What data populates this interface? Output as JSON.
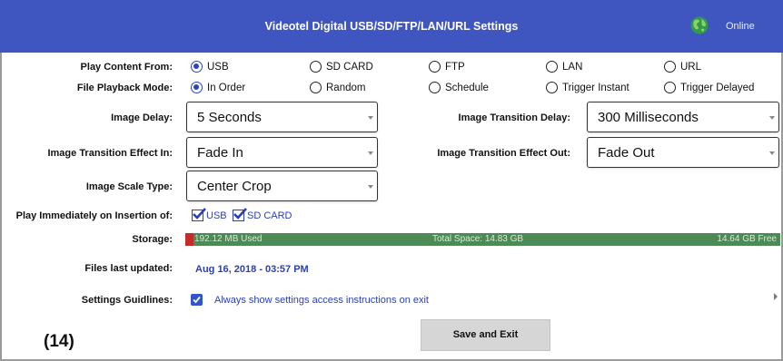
{
  "header": {
    "title": "Videotel Digital USB/SD/FTP/LAN/URL Settings",
    "status": "Online",
    "color": "#3f56c0"
  },
  "play_content": {
    "label": "Play Content From:",
    "options": [
      "USB",
      "SD CARD",
      "FTP",
      "LAN",
      "URL"
    ],
    "selected": "USB"
  },
  "playback_mode": {
    "label": "File Playback Mode:",
    "options": [
      "In Order",
      "Random",
      "Schedule",
      "Trigger Instant",
      "Trigger Delayed"
    ],
    "selected": "In Order"
  },
  "image_delay": {
    "label": "Image Delay:",
    "value": "5 Seconds"
  },
  "transition_delay": {
    "label": "Image Transition Delay:",
    "value": "300 Milliseconds"
  },
  "effect_in": {
    "label": "Image Transition Effect In:",
    "value": "Fade In"
  },
  "effect_out": {
    "label": "Image Transition Effect Out:",
    "value": "Fade Out"
  },
  "scale_type": {
    "label": "Image Scale Type:",
    "value": "Center Crop"
  },
  "play_on_insert": {
    "label": "Play Immediately on Insertion of:",
    "options": [
      {
        "label": "USB",
        "checked": true
      },
      {
        "label": "SD CARD",
        "checked": true
      }
    ]
  },
  "storage": {
    "label": "Storage:",
    "used": "192.12 MB Used",
    "total": "Total Space: 14.83 GB",
    "free": "14.64 GB Free",
    "used_fraction": 0.013
  },
  "files_updated": {
    "label": "Files last updated:",
    "value": "Aug 16, 2018 - 03:57 PM"
  },
  "guidelines": {
    "label": "Settings Guidlines:",
    "checkbox_label": "Always show settings access instructions on exit",
    "checked": true
  },
  "save_button": "Save and Exit",
  "figure_number": "(14)",
  "colors": {
    "accent": "#2a3fb5",
    "storage_bar": "#4e8a55",
    "storage_used": "#c42b2b"
  }
}
